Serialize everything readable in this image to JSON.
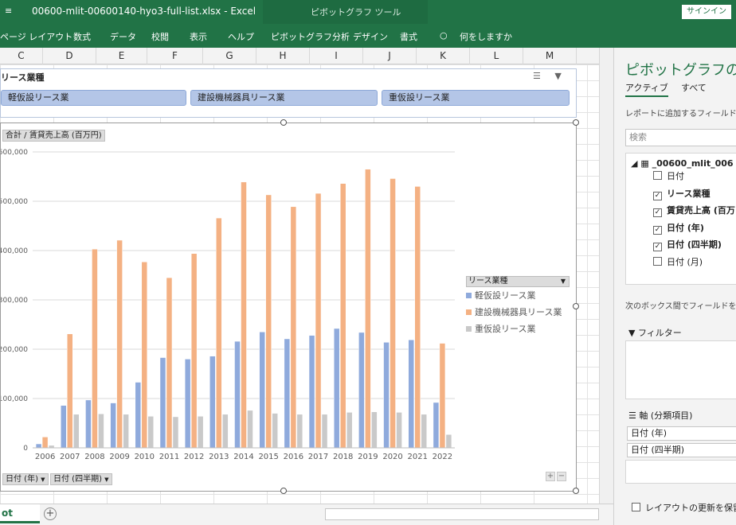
{
  "titlebar": {
    "quick_access": "≡",
    "title": "00600-mlit-00600140-hyo3-full-list.xlsx  -  Excel",
    "context_tools": "ピボットグラフ ツール",
    "signin": "サインイン"
  },
  "ribbon": {
    "tabs": [
      "ページ レイアウト",
      "数式",
      "データ",
      "校閲",
      "表示",
      "ヘルプ",
      "ピボットグラフ分析",
      "デザイン",
      "書式"
    ],
    "tell_me": "何をしますか",
    "tell_me_icon": "lightbulb-icon"
  },
  "columns": [
    "C",
    "D",
    "E",
    "F",
    "G",
    "H",
    "I",
    "J",
    "K",
    "L",
    "M"
  ],
  "slicer": {
    "title": "リース業種",
    "icons": "multi-select-icon clear-filter-icon",
    "items": [
      "軽仮設リース業",
      "建設機械器具リース業",
      "重仮設リース業"
    ]
  },
  "chart_data": {
    "type": "bar",
    "value_field_button": "合計 / 賃貸売上高 (百万円)",
    "categories": [
      "2006",
      "2007",
      "2008",
      "2009",
      "2010",
      "2011",
      "2012",
      "2013",
      "2014",
      "2015",
      "2016",
      "2017",
      "2018",
      "2019",
      "2020",
      "2021",
      "2022"
    ],
    "ylim": [
      0,
      600000
    ],
    "yticks": [
      0,
      100000,
      200000,
      300000,
      400000,
      500000,
      600000
    ],
    "ytick_labels": [
      "0",
      "100,000",
      "200,000",
      "300,000",
      "400,000",
      "500,000",
      "600,000"
    ],
    "grid": true,
    "legend_title": "リース業種",
    "legend_position": "right",
    "series": [
      {
        "name": "軽仮設リース業",
        "color": "#8faadc",
        "values": [
          8000,
          86000,
          97000,
          91000,
          133000,
          183000,
          180000,
          186000,
          216000,
          235000,
          221000,
          228000,
          242000,
          234000,
          214000,
          219000,
          92000
        ]
      },
      {
        "name": "建設機械器具リース業",
        "color": "#f4b183",
        "values": [
          22000,
          231000,
          403000,
          421000,
          377000,
          345000,
          394000,
          466000,
          539000,
          513000,
          489000,
          516000,
          536000,
          565000,
          546000,
          530000,
          212000
        ]
      },
      {
        "name": "重仮設リース業",
        "color": "#c9c9c9",
        "values": [
          5000,
          68000,
          69000,
          68000,
          64000,
          63000,
          64000,
          68000,
          76000,
          70000,
          68000,
          68000,
          72000,
          73000,
          72000,
          68000,
          27000
        ]
      }
    ],
    "axis_field_buttons": [
      "日付 (年)",
      "日付 (四半期)"
    ]
  },
  "zoom_buttons": [
    "+",
    "−"
  ],
  "sheet": {
    "active_tab": "ot",
    "add_icon": "plus-circle-icon"
  },
  "panel": {
    "title": "ピボットグラフのフィ",
    "tab_active": "アクティブ",
    "tab_all": "すべて",
    "hint": "レポートに追加するフィールドを選",
    "search_placeholder": "検索",
    "table_name": "_00600_mlit_006",
    "fields": [
      {
        "label": "日付",
        "checked": false
      },
      {
        "label": "リース業種",
        "checked": true
      },
      {
        "label": "賃貸売上高 (百万",
        "checked": true
      },
      {
        "label": "日付 (年)",
        "checked": true
      },
      {
        "label": "日付 (四半期)",
        "checked": true
      },
      {
        "label": "日付 (月)",
        "checked": false
      }
    ],
    "drag_hint": "次のボックス間でフィールドをドラ",
    "filter_label": "フィルター",
    "axis_label": "軸 (分類項目)",
    "axis_items": [
      "日付 (年)",
      "日付 (四半期)"
    ],
    "defer_label": "レイアウトの更新を保留す"
  }
}
